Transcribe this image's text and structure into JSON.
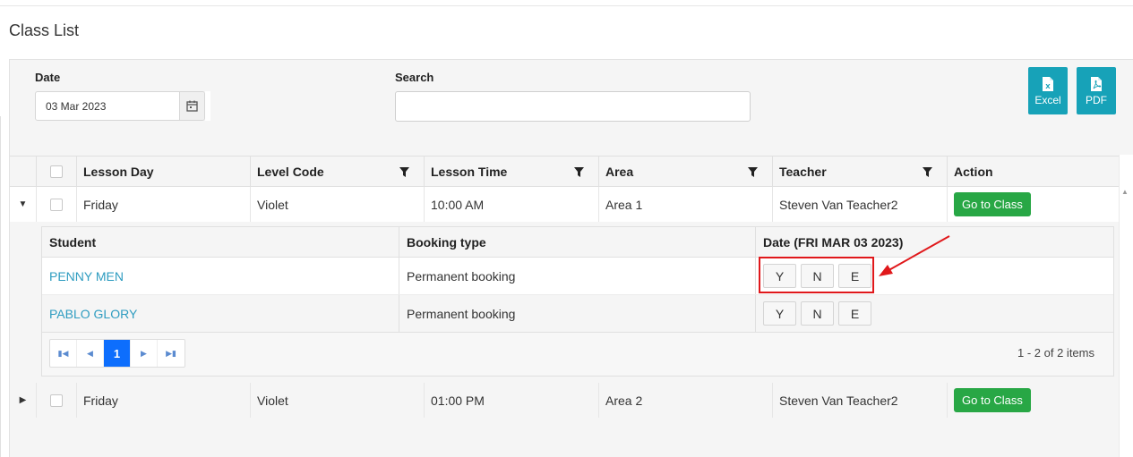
{
  "page": {
    "title": "Class List"
  },
  "filters": {
    "date_label": "Date",
    "date_value": "03 Mar 2023",
    "search_label": "Search",
    "search_value": "",
    "search_placeholder": ""
  },
  "export": {
    "excel_label": "Excel",
    "pdf_label": "PDF",
    "accent": "#17a2b8"
  },
  "grid": {
    "columns": [
      "Lesson Day",
      "Level Code",
      "Lesson Time",
      "Area",
      "Teacher",
      "Action"
    ],
    "rows": [
      {
        "day": "Friday",
        "level": "Violet",
        "time": "10:00 AM",
        "area": "Area 1",
        "teacher": "Steven Van Teacher2",
        "action": "Go to Class",
        "expanded": true
      },
      {
        "day": "Friday",
        "level": "Violet",
        "time": "01:00 PM",
        "area": "Area 2",
        "teacher": "Steven Van Teacher2",
        "action": "Go to Class",
        "expanded": false
      }
    ]
  },
  "detail": {
    "columns": [
      "Student",
      "Booking type",
      "Date (FRI MAR 03 2023)"
    ],
    "rows": [
      {
        "student": "PENNY MEN",
        "booking": "Permanent booking",
        "options": [
          "Y",
          "N",
          "E"
        ]
      },
      {
        "student": "PABLO GLORY",
        "booking": "Permanent booking",
        "options": [
          "Y",
          "N",
          "E"
        ]
      }
    ],
    "pager": {
      "current_page": "1",
      "info": "1 - 2 of 2 items"
    }
  },
  "colors": {
    "go_button": "#28a745",
    "link": "#2e9cc0",
    "highlight": "#e0181b",
    "page_active": "#0d6efd"
  }
}
